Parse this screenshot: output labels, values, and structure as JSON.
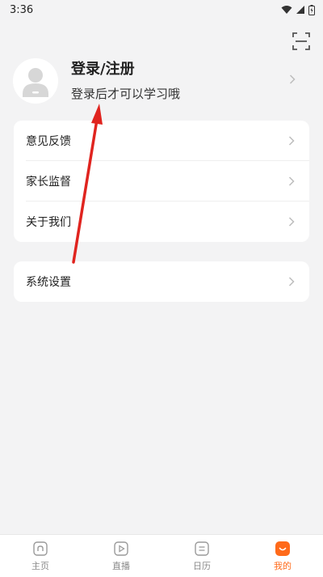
{
  "status_bar": {
    "time": "3:36",
    "icons": [
      "wifi-icon",
      "signal-icon",
      "battery-icon"
    ]
  },
  "header": {
    "scan_icon": "scan-icon"
  },
  "profile": {
    "title": "登录/注册",
    "subtitle": "登录后才可以学习哦",
    "avatar_icon": "default-avatar-icon"
  },
  "menu_group_1": [
    {
      "label": "意见反馈"
    },
    {
      "label": "家长监督"
    },
    {
      "label": "关于我们"
    }
  ],
  "menu_group_2": [
    {
      "label": "系统设置"
    }
  ],
  "bottom_nav": [
    {
      "label": "主页",
      "icon": "home-icon",
      "active": false
    },
    {
      "label": "直播",
      "icon": "live-icon",
      "active": false
    },
    {
      "label": "日历",
      "icon": "calendar-icon",
      "active": false
    },
    {
      "label": "我的",
      "icon": "profile-icon",
      "active": true
    }
  ],
  "colors": {
    "accent": "#ff6a1a",
    "annotation_arrow": "#e0241f",
    "background": "#f3f3f4"
  }
}
